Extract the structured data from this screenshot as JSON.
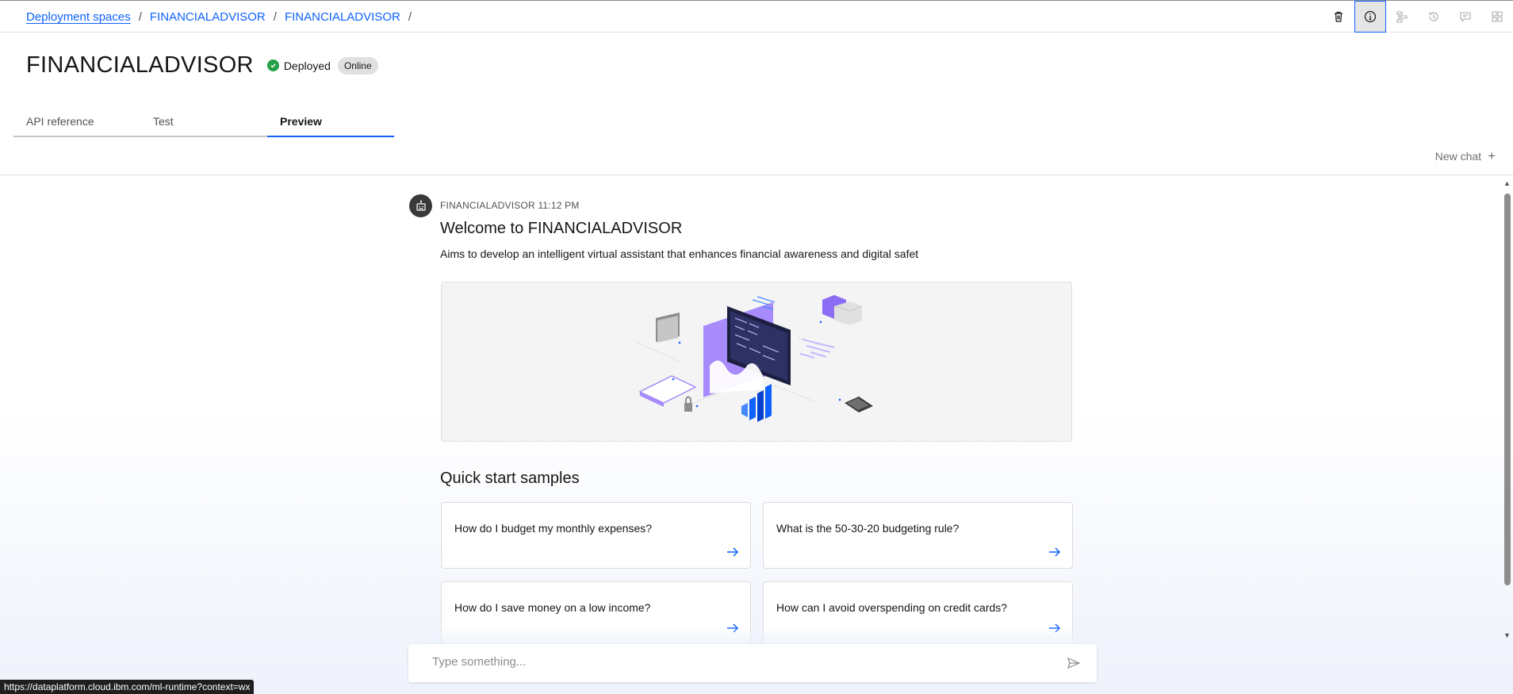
{
  "breadcrumb": {
    "items": [
      "Deployment spaces",
      "FINANCIALADVISOR",
      "FINANCIALADVISOR"
    ],
    "separator": "/"
  },
  "toolbar": {
    "icons": [
      "trash-icon",
      "info-icon",
      "structure-icon",
      "history-icon",
      "comment-icon",
      "layout-icon"
    ]
  },
  "header": {
    "title": "FINANCIALADVISOR",
    "status": "Deployed",
    "badge": "Online"
  },
  "tabs": [
    {
      "label": "API reference"
    },
    {
      "label": "Test"
    },
    {
      "label": "Preview"
    }
  ],
  "chat": {
    "new_chat": "New chat",
    "sender": "FINANCIALADVISOR",
    "time": "11:12 PM",
    "welcome": "Welcome to FINANCIALADVISOR",
    "description": "Aims to develop an intelligent virtual assistant that enhances financial awareness and digital safet",
    "quick_start_title": "Quick start samples",
    "samples": [
      "How do I budget my monthly expenses?",
      "What is the 50-30-20 budgeting rule?",
      "How do I save money on a low income?",
      "How can I avoid overspending on credit cards?"
    ],
    "input_placeholder": "Type something..."
  },
  "status_url": "https://dataplatform.cloud.ibm.com/ml-runtime?context=wx",
  "colors": {
    "accent": "#0f62fe",
    "success": "#24a148",
    "illustration_purple": "#8a6cf5"
  }
}
